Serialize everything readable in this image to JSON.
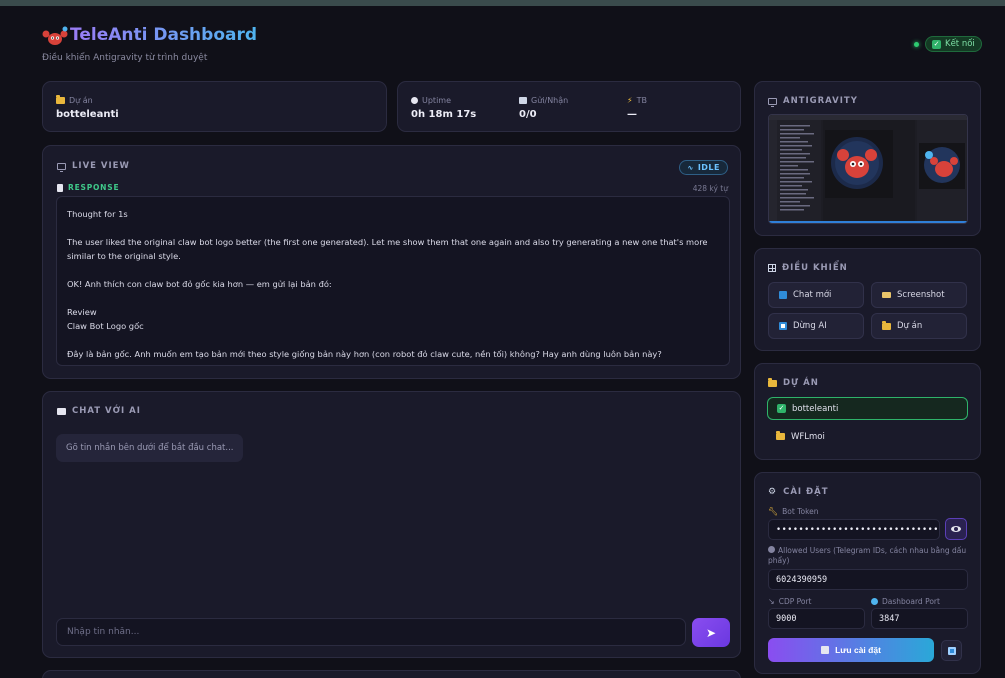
{
  "header": {
    "title": "TeleAnti Dashboard",
    "subtitle": "Điều khiển Antigravity từ trình duyệt",
    "connection_status": "Kết nối"
  },
  "stats": {
    "project_label": "Dự án",
    "project_value": "botteleanti",
    "uptime_label": "Uptime",
    "uptime_value": "0h 18m 17s",
    "sent_received_label": "Gửi/Nhận",
    "sent_received_value": "0/0",
    "tb_label": "TB",
    "tb_value": "—"
  },
  "live_view": {
    "title": "LIVE VIEW",
    "status_badge": "IDLE",
    "response_label": "RESPONSE",
    "char_count": "428 ký tự",
    "response_lines": [
      "Thought for 1s",
      "",
      "The user liked the original claw bot logo better (the first one generated). Let me show them that one again and also try generating a new one that's more similar to the original style.",
      "",
      "OK! Anh thích con claw bot đỏ gốc kia hơn — em gửi lại bản đó:",
      "",
      "Review",
      "Claw Bot Logo gốc",
      "",
      "Đây là bản gốc. Anh muốn em tạo bản mới theo style giống bản này hơn (con robot đỏ claw cute, nền tối) không? Hay anh dùng luôn bản này?"
    ]
  },
  "chat": {
    "title": "CHAT VỚI AI",
    "empty_message": "Gõ tin nhắn bên dưới để bắt đầu chat...",
    "input_placeholder": "Nhập tin nhắn..."
  },
  "antigravity": {
    "title": "ANTIGRAVITY"
  },
  "controls": {
    "title": "ĐIỀU KHIỂN",
    "new_chat": "Chat mới",
    "screenshot": "Screenshot",
    "stop_ai": "Dừng AI",
    "project": "Dự án"
  },
  "projects": {
    "title": "DỰ ÁN",
    "items": [
      {
        "name": "botteleanti",
        "active": true
      },
      {
        "name": "WFLmoi",
        "active": false
      }
    ]
  },
  "settings": {
    "title": "CÀI ĐẶT",
    "bot_token_label": "Bot Token",
    "bot_token_value": "••••••••••••••••••••••••••••••••••",
    "allowed_users_label": "Allowed Users (Telegram IDs, cách nhau bằng dấu phẩy)",
    "allowed_users_value": "6024390959",
    "cdp_port_label": "CDP Port",
    "cdp_port_value": "9000",
    "dashboard_port_label": "Dashboard Port",
    "dashboard_port_value": "3847",
    "save_label": "Lưu cài đặt"
  },
  "colors": {
    "accent_purple": "#8a4df0",
    "accent_blue": "#2aa8d8",
    "success_green": "#2fb36a",
    "idle_blue": "#6cc2ff"
  }
}
